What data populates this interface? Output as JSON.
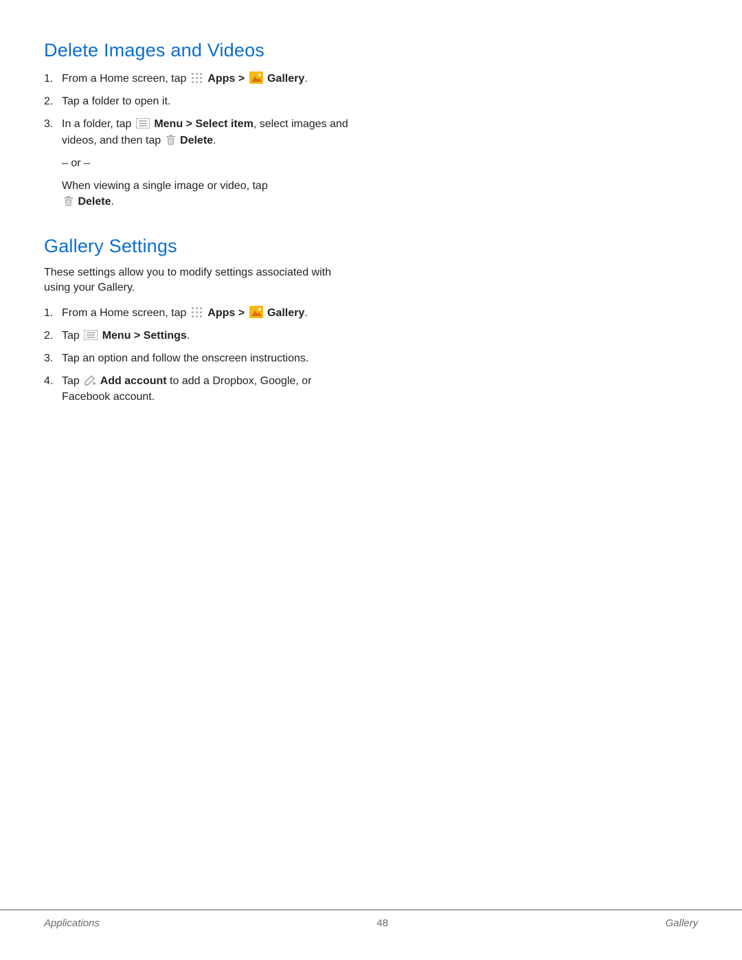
{
  "section1": {
    "heading": "Delete Images and Videos",
    "steps": {
      "s1": {
        "pre": "From a Home screen, tap ",
        "apps": "Apps",
        "gt": " > ",
        "gallery": "Gallery",
        "post": "."
      },
      "s2": "Tap a folder to open it.",
      "s3": {
        "pre": "In a folder, tap ",
        "menu": "Menu > Select item",
        "mid": ", select images and videos, and then tap ",
        "delete": "Delete",
        "post": "."
      },
      "or": "– or –",
      "alt": {
        "line1": "When viewing a single image or video, tap",
        "delete": "Delete",
        "post": "."
      }
    }
  },
  "section2": {
    "heading": "Gallery Settings",
    "intro": "These settings allow you to modify settings associated with using your Gallery.",
    "steps": {
      "s1": {
        "pre": "From a Home screen, tap ",
        "apps": "Apps",
        "gt": " > ",
        "gallery": "Gallery",
        "post": "."
      },
      "s2": {
        "pre": "Tap ",
        "menu": "Menu > Settings",
        "post": "."
      },
      "s3": "Tap an option and follow the onscreen instructions.",
      "s4": {
        "pre": "Tap ",
        "add": "Add account",
        "post": " to add a Dropbox, Google, or Facebook account."
      }
    }
  },
  "footer": {
    "left": "Applications",
    "center": "48",
    "right": "Gallery"
  }
}
